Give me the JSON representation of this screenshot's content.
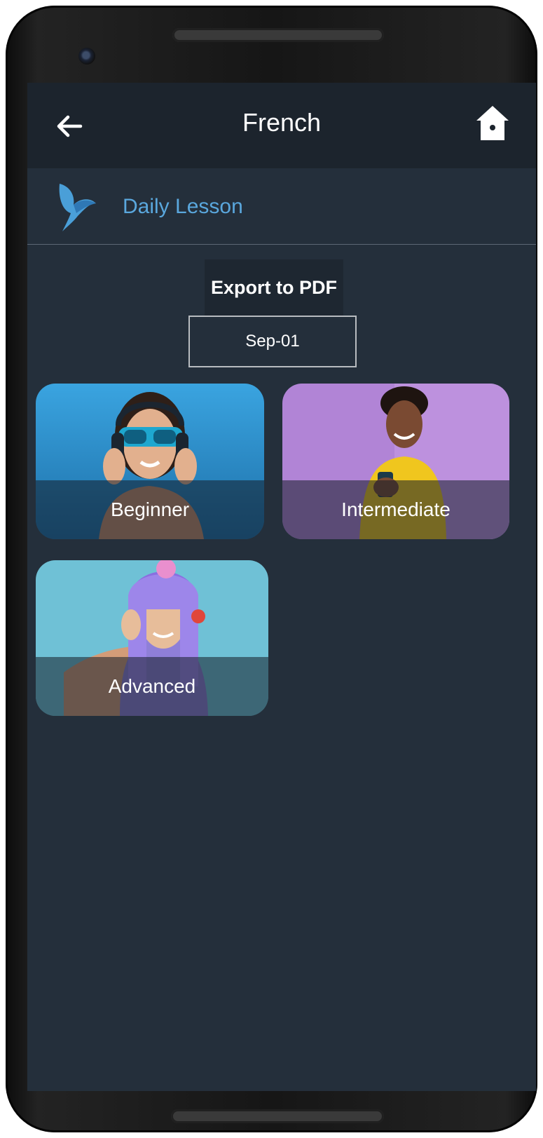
{
  "header": {
    "title": "French",
    "back_icon": "arrow-left-icon",
    "home_icon": "home-icon"
  },
  "lesson": {
    "label": "Daily Lesson",
    "icon": "bird-logo-icon"
  },
  "actions": {
    "export_label": "Export to PDF"
  },
  "date": {
    "value": "Sep-01"
  },
  "levels": [
    {
      "label": "Beginner"
    },
    {
      "label": "Intermediate"
    },
    {
      "label": "Advanced"
    }
  ],
  "colors": {
    "screen_bg": "#242f3b",
    "appbar_bg": "#1c242d",
    "accent": "#5aa7dd",
    "beginner_bg": "#2e8fcf",
    "intermediate_bg": "#b184d6",
    "advanced_bg": "#6fc1d6"
  }
}
